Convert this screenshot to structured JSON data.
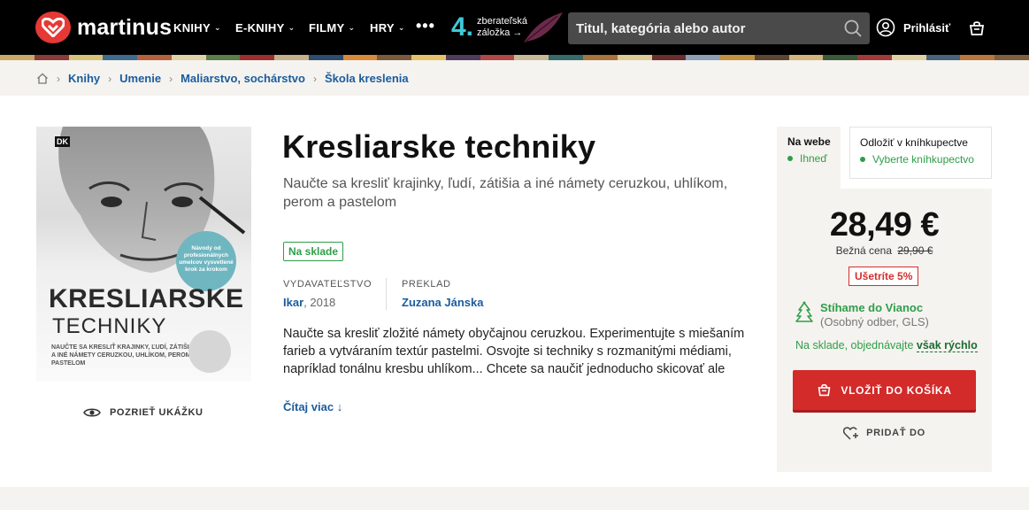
{
  "header": {
    "logo_text": "martinus",
    "nav": [
      {
        "label": "KNIHY"
      },
      {
        "label": "E-KNIHY"
      },
      {
        "label": "FILMY"
      },
      {
        "label": "HRY"
      }
    ],
    "more_label": "•••",
    "promo": {
      "number": "4.",
      "line1": "zberateľská",
      "line2": "záložka →"
    },
    "search_placeholder": "Titul, kategória alebo autor",
    "login_label": "Prihlásiť"
  },
  "breadcrumb": [
    "Knihy",
    "Umenie",
    "Maliarstvo, sochárstvo",
    "Škola kreslenia"
  ],
  "book": {
    "title": "Kresliarske techniky",
    "subtitle": "Naučte sa kresliť krajinky, ľudí, zátišia a iné námety ceruzkou, uhlíkom, perom a pastelom",
    "stock_badge": "Na sklade",
    "publisher_label": "VYDAVATEĽSTVO",
    "publisher": "Ikar",
    "year": ", 2018",
    "translation_label": "PREKLAD",
    "translator": "Zuzana Jánska",
    "description": "Naučte sa kresliť zložité námety obyčajnou ceruzkou. Experimentujte s miešaním farieb a vytváraním textúr pastelmi. Osvojte si techniky s rozmanitými médiami, napríklad tonálnu kresbu uhlíkom... Chcete sa naučiť jednoducho skicovať ale",
    "read_more": "Čítaj viac ↓",
    "preview_label": "POZRIEŤ UKÁŽKU",
    "cover": {
      "publisher_mark": "DK",
      "title_line1": "KRESLIARSKE",
      "title_line2": "TECHNIKY",
      "subtitle": "NAUČTE SA KRESLIŤ KRAJINKY, ĽUDÍ, ZÁTIŠIA A INÉ NÁMETY CERUZKOU, UHLÍKOM, PEROM A PASTELOM",
      "seal": "Návody od profesionálnych umelcov vysvetlené krok za krokom"
    }
  },
  "purchase": {
    "tab_web_title": "Na webe",
    "tab_web_status": "Ihneď",
    "tab_store_title": "Odložiť v kníhkupectve",
    "tab_store_status": "Vyberte kníhkupectvo",
    "price": "28,49 €",
    "regular_label": "Bežná cena",
    "regular_price": "29,90 €",
    "save_label": "Ušetríte 5%",
    "xmas_title": "Stíhame do Vianoc",
    "xmas_detail": "(Osobný odber, GLS)",
    "availability": "Na sklade, objednávajte ",
    "availability_fast": "však rýchlo",
    "buy_label": "VLOŽIŤ DO KOŠÍKA",
    "wishlist_label": "PRIDAŤ DO"
  },
  "colors": {
    "accent_red": "#d32a2a",
    "link_blue": "#1a5c9e",
    "green": "#2e9e49",
    "panel_bg": "#f5f3ef"
  }
}
